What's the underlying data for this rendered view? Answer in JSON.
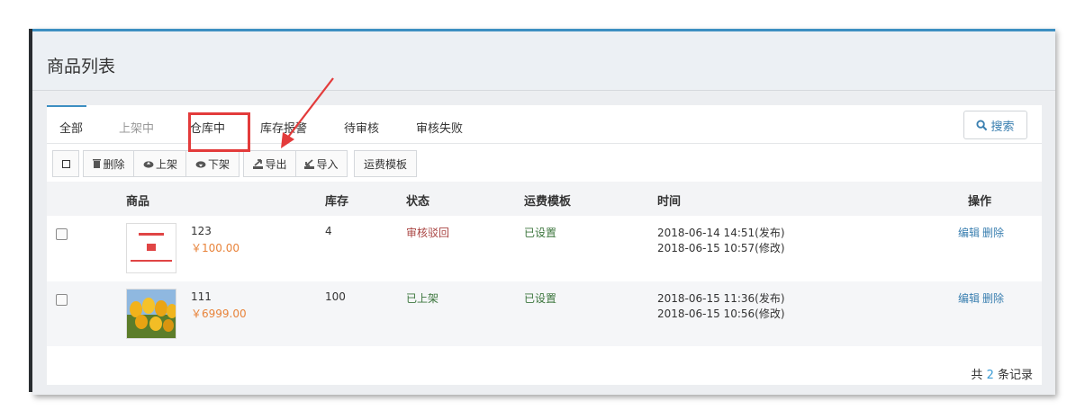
{
  "header": {
    "title": "商品列表"
  },
  "tabs": [
    {
      "label": "全部"
    },
    {
      "label": "上架中"
    },
    {
      "label": "仓库中"
    },
    {
      "label": "库存报警"
    },
    {
      "label": "待审核"
    },
    {
      "label": "审核失败"
    }
  ],
  "search": {
    "label": "搜索",
    "icon": "search-icon"
  },
  "toolbar": {
    "delete": "删除",
    "shelve": "上架",
    "unshelve": "下架",
    "export": "导出",
    "import": "导入",
    "shipping_template": "运费模板"
  },
  "table": {
    "columns": {
      "product": "商品",
      "stock": "库存",
      "status": "状态",
      "shipping": "运费模板",
      "time": "时间",
      "actions": "操作"
    },
    "rows": [
      {
        "name": "123",
        "price": "￥100.00",
        "stock": "4",
        "status": "审核驳回",
        "shipping": "已设置",
        "published": "2018-06-14 14:51(发布)",
        "modified": "2018-06-15 10:57(修改)",
        "edit": "编辑",
        "delete": "删除"
      },
      {
        "name": "111",
        "price": "￥6999.00",
        "stock": "100",
        "status": "已上架",
        "shipping": "已设置",
        "published": "2018-06-15 11:36(发布)",
        "modified": "2018-06-15 10:56(修改)",
        "edit": "编辑",
        "delete": "删除"
      }
    ]
  },
  "footer": {
    "prefix": "共",
    "count": "2",
    "suffix": "条记录"
  },
  "colors": {
    "accent": "#3d8fc2",
    "highlight": "#e33b3b",
    "price": "#e8833a",
    "rejected": "#a94442",
    "ok": "#3c763d"
  }
}
